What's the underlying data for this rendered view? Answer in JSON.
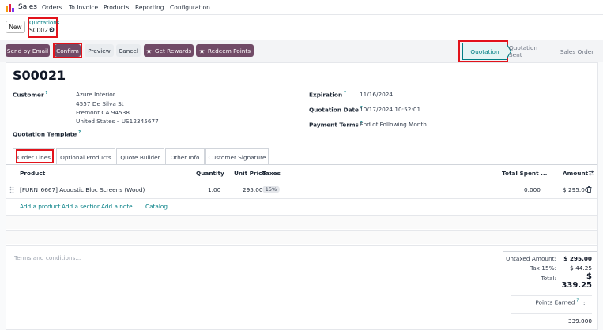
{
  "nav": {
    "app_name": "Sales",
    "menu": [
      "Orders",
      "To Invoice",
      "Products",
      "Reporting",
      "Configuration"
    ]
  },
  "breadcrumb": {
    "new_label": "New",
    "parent": "Quotations",
    "current": "S00021"
  },
  "actions": {
    "send_email": "Send by Email",
    "confirm": "Confirm",
    "preview": "Preview",
    "cancel": "Cancel",
    "get_rewards": "Get Rewards",
    "redeem_points": "Redeem Points"
  },
  "statusbar": {
    "steps": [
      "Quotation",
      "Quotation Sent",
      "Sales Order"
    ],
    "active": "Quotation"
  },
  "form": {
    "title": "S00021",
    "customer_label": "Customer",
    "customer_lines": [
      "Azure Interior",
      "4557 De Silva St",
      "Fremont CA 94538",
      "United States – US12345677"
    ],
    "template_label": "Quotation Template",
    "expiration_label": "Expiration",
    "expiration_value": "11/16/2024",
    "quotation_date_label": "Quotation Date",
    "quotation_date_value": "10/17/2024 10:52:01",
    "payment_terms_label": "Payment Terms",
    "payment_terms_value": "End of Following Month",
    "help_mark": "?"
  },
  "tabs": [
    "Order Lines",
    "Optional Products",
    "Quote Builder",
    "Other Info",
    "Customer Signature"
  ],
  "table": {
    "columns": {
      "product": "Product",
      "quantity": "Quantity",
      "unit_price": "Unit Price",
      "taxes": "Taxes",
      "total_spent": "Total Spent ...",
      "amount": "Amount"
    },
    "rows": [
      {
        "product": "[FURN_6667] Acoustic Bloc Screens (Wood)",
        "quantity": "1.00",
        "unit_price": "295.00",
        "tax": "15%",
        "total_spent": "0.000",
        "amount": "$ 295.00"
      }
    ],
    "links": [
      "Add a product",
      "Add a section",
      "Add a note",
      "Catalog"
    ]
  },
  "footer": {
    "terms_placeholder": "Terms and conditions...",
    "untaxed_label": "Untaxed Amount:",
    "untaxed_value": "$ 295.00",
    "tax_label": "Tax 15%:",
    "tax_value": "$ 44.25",
    "total_label": "Total:",
    "total_value": "$ 339.25",
    "points_label": "Points Earned",
    "points_value": "339.000"
  },
  "colors": {
    "brand": "#714b67",
    "accent": "#017e84",
    "highlight": "#e2131b"
  }
}
